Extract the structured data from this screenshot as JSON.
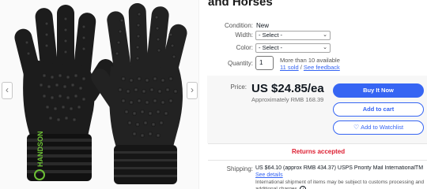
{
  "listing": {
    "title": "and Horses"
  },
  "gallery": {
    "prev_icon": "‹",
    "next_icon": "›",
    "brand_text": "HANDSON"
  },
  "item": {
    "condition_label": "Condition:",
    "condition_value": "New",
    "width_label": "Width:",
    "width_value": "- Select -",
    "color_label": "Color:",
    "color_value": "- Select -",
    "quantity_label": "Quantity:",
    "quantity_value": "1",
    "availability": "More than 10 available",
    "sold_link": "11 sold",
    "separator": "/",
    "feedback_link": "See feedback"
  },
  "price": {
    "label": "Price:",
    "value": "US $24.85/ea",
    "approx": "Approximately RMB 168.39"
  },
  "buttons": {
    "buy": "Buy It Now",
    "cart": "Add to cart",
    "watchlist": "Add to Watchlist"
  },
  "returns": {
    "text": "Returns accepted"
  },
  "shipping": {
    "label": "Shipping:",
    "value": "US $64.10 (approx RMB 434.37) USPS Priority Mail InternationalTM |",
    "details_link": "See details",
    "note": "International shipment of items may be subject to customs processing and additional charges."
  },
  "colors": {
    "accent": "#3665f3",
    "returns": "#dd1e31",
    "glove_logo": "#6dc036"
  },
  "icons": {
    "heart": "heart-icon",
    "chevron": "chevron-down-icon",
    "info": "info-icon"
  }
}
